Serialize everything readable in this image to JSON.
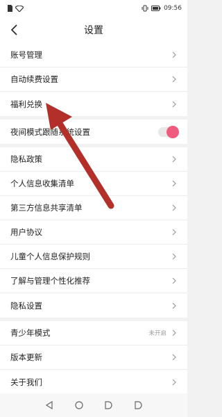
{
  "status_bar": {
    "time": "09:56",
    "left_icons": [
      "sim-icon",
      "wifi-icon"
    ],
    "right_icons": [
      "vibrate-icon",
      "battery-icon"
    ]
  },
  "header": {
    "title": "设置",
    "back_icon": "chevron-left-icon"
  },
  "groups": [
    {
      "items": [
        {
          "label": "账号管理"
        },
        {
          "label": "自动续费设置"
        },
        {
          "label": "福利兑换"
        }
      ]
    },
    {
      "items": [
        {
          "label": "夜间模式跟随系统设置",
          "toggle": true,
          "toggle_on": true
        }
      ]
    },
    {
      "items": [
        {
          "label": "隐私政策"
        },
        {
          "label": "个人信息收集清单"
        },
        {
          "label": "第三方信息共享清单"
        },
        {
          "label": "用户协议"
        },
        {
          "label": "儿童个人信息保护规则"
        },
        {
          "label": "了解与管理个性化推荐"
        },
        {
          "label": "隐私设置"
        }
      ]
    },
    {
      "items": [
        {
          "label": "青少年模式",
          "value": "未开启"
        },
        {
          "label": "版本更新"
        },
        {
          "label": "关于我们"
        }
      ]
    }
  ],
  "colors": {
    "toggle_on": "#f05a7e",
    "annotation_arrow": "#b3302a",
    "background": "#f2f2f2"
  },
  "nav_bar": {
    "buttons": [
      "back-triangle-icon",
      "home-circle-icon",
      "recent-d-icon",
      "recent-d-icon"
    ]
  }
}
